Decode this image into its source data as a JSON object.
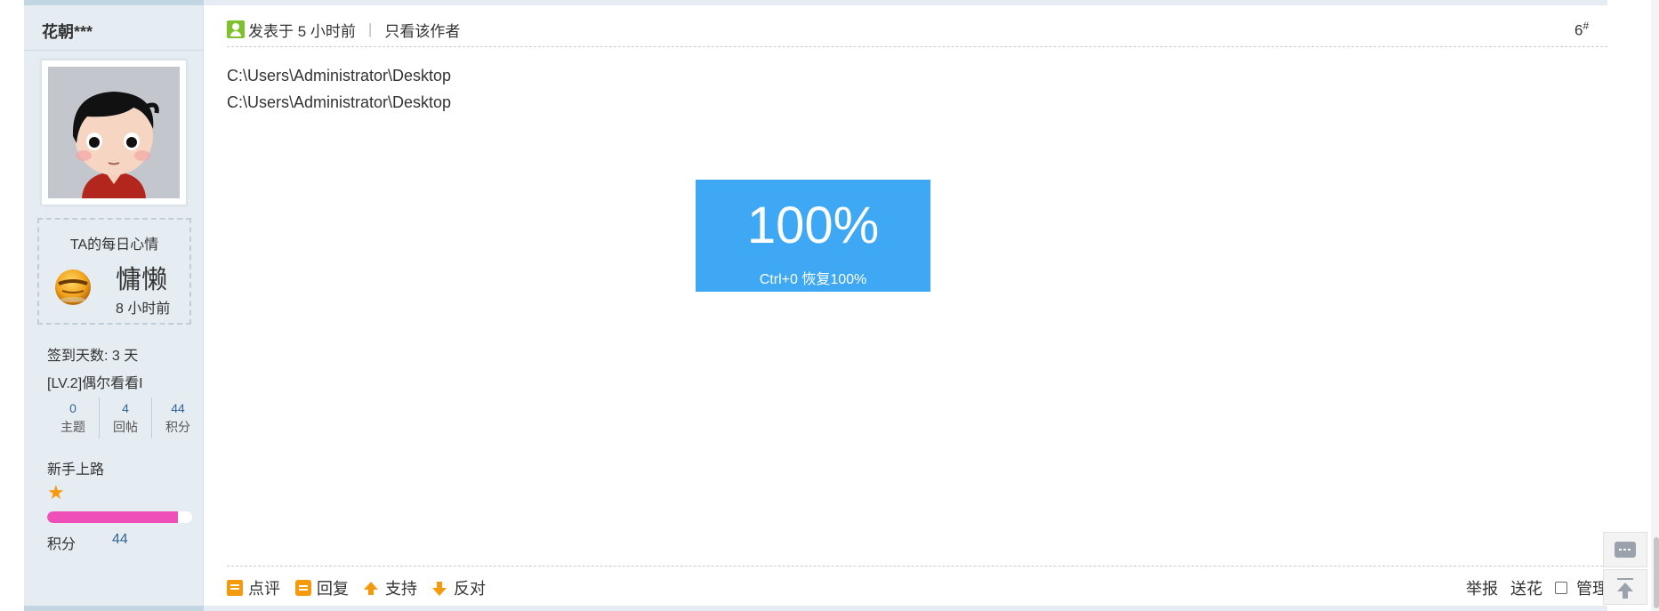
{
  "author": {
    "name": "花朝***"
  },
  "mood": {
    "title": "TA的每日心情",
    "word": "慵懒",
    "time": "8 小时前"
  },
  "profile": {
    "sign_days": "签到天数: 3 天",
    "level": "[LV.2]偶尔看看I",
    "stats": [
      {
        "num": "0",
        "label": "主题"
      },
      {
        "num": "4",
        "label": "回帖"
      },
      {
        "num": "44",
        "label": "积分"
      }
    ],
    "rank": "新手上路",
    "progress": 0.9,
    "score_label": "积分",
    "score_value": "44"
  },
  "post": {
    "posted": "发表于 5 小时前",
    "only_author": "只看该作者",
    "floor": "6",
    "floor_mark": "#",
    "lines": [
      "C:\\Users\\Administrator\\Desktop",
      "C:\\Users\\Administrator\\Desktop"
    ]
  },
  "zoom": {
    "percent": "100%",
    "hint": "Ctrl+0 恢复100%"
  },
  "actions": {
    "comment": "点评",
    "reply": "回复",
    "support": "支持",
    "oppose": "反对",
    "report": "举报",
    "flower": "送花",
    "manage": "管理"
  },
  "colors": {
    "accent": "#f59a0c",
    "zoom_bg": "#3ea8f5",
    "bar": "#ee4fb8",
    "link": "#336699"
  }
}
